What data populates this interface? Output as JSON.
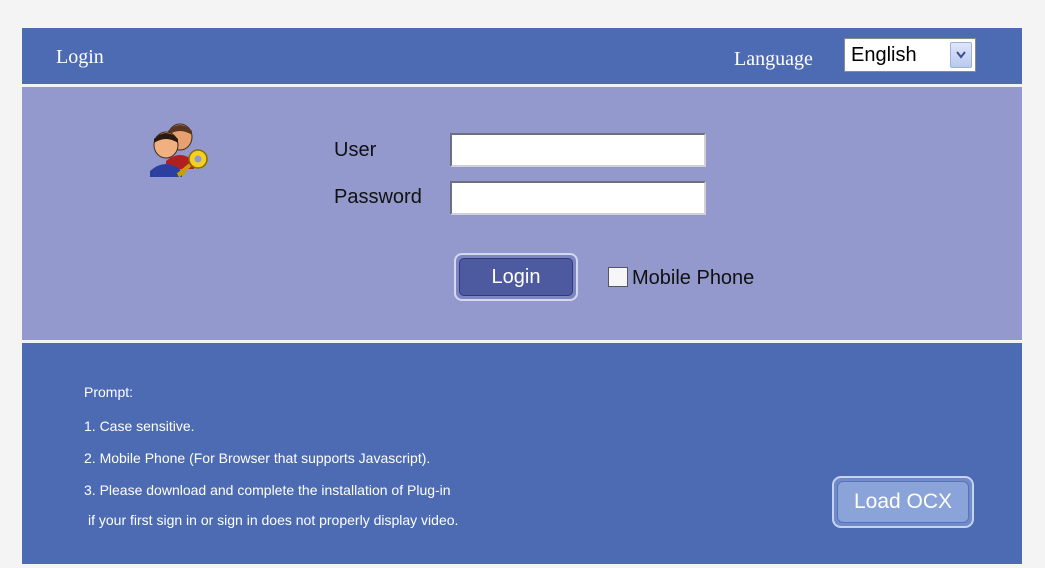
{
  "header": {
    "title": "Login",
    "language_label": "Language",
    "language_selected": "English"
  },
  "form": {
    "user_label": "User",
    "user_value": "",
    "password_label": "Password",
    "password_value": "",
    "login_button": "Login",
    "mobile_phone_label": "Mobile Phone",
    "mobile_phone_checked": false
  },
  "prompt": {
    "title": "Prompt:",
    "lines": [
      "1. Case sensitive.",
      "2. Mobile Phone (For Browser that supports Javascript).",
      "3. Please download and complete the installation of Plug-in",
      " if your first sign in or sign in does not properly display video."
    ],
    "load_ocx_button": "Load OCX"
  },
  "icons": {
    "users_key": "users-key-icon",
    "dropdown_arrow": "chevron-down-icon"
  },
  "colors": {
    "header_bg": "#4c6bb3",
    "form_bg": "#9399cc",
    "prompt_bg": "#4c6bb3",
    "button_bg": "#4d5aa0"
  }
}
